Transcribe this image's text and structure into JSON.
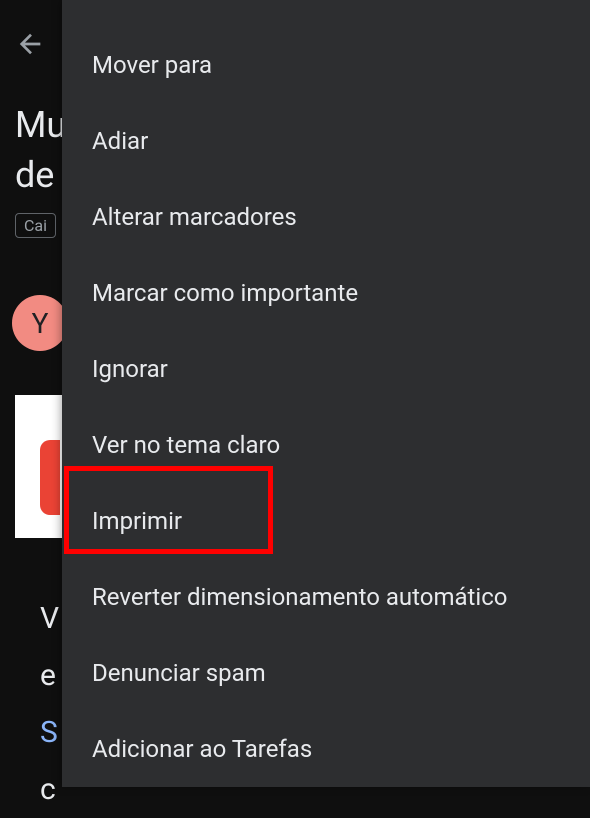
{
  "background": {
    "title_line1": "Mu",
    "title_line2": "de",
    "label_badge": "Cai",
    "avatar_letter": "Y",
    "body_lines": [
      "V",
      "e",
      "S",
      "c"
    ]
  },
  "menu": {
    "items": [
      {
        "label": "Mover para"
      },
      {
        "label": "Adiar"
      },
      {
        "label": "Alterar marcadores"
      },
      {
        "label": "Marcar como importante"
      },
      {
        "label": "Ignorar"
      },
      {
        "label": "Ver no tema claro"
      },
      {
        "label": "Imprimir"
      },
      {
        "label": "Reverter dimensionamento automático"
      },
      {
        "label": "Denunciar spam"
      },
      {
        "label": "Adicionar ao Tarefas"
      }
    ]
  }
}
